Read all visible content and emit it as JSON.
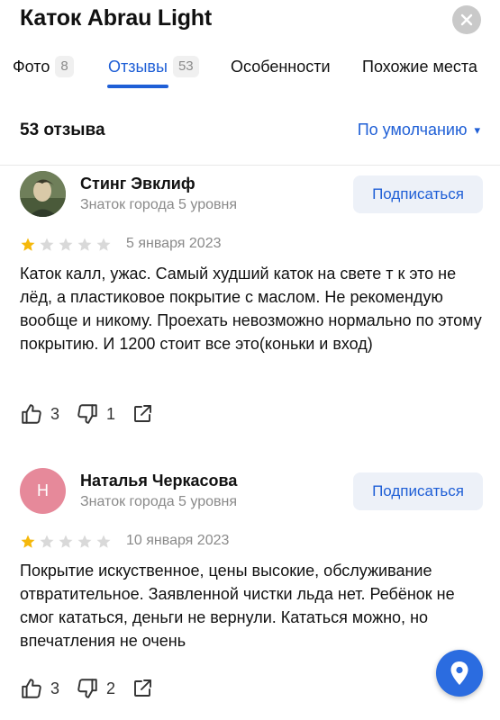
{
  "header": {
    "title": "Каток Abrau Light"
  },
  "tabs": [
    {
      "label": "Фото",
      "count": "8"
    },
    {
      "label": "Отзывы",
      "count": "53"
    },
    {
      "label": "Особенности"
    },
    {
      "label": "Похожие места"
    }
  ],
  "summary": {
    "count_text": "53 отзыва",
    "sort_label": "По умолчанию",
    "sort_caret": "▾"
  },
  "reviews": [
    {
      "author": "Стинг Эвклиф",
      "level": "Знаток города 5 уровня",
      "subscribe_label": "Подписаться",
      "rating": 1,
      "date": "5 января 2023",
      "text": "Каток калл, ужас. Самый худший каток на свете т к это не лёд, а пластиковое покрытие с маслом. Не рекомендую вообще и никому. Проехать невозможно нормально по этому покрытию. И 1200 стоит все это(коньки и вход)",
      "likes": "3",
      "dislikes": "1"
    },
    {
      "author": "Наталья Черкасова",
      "avatar_initial": "Н",
      "level": "Знаток города 5 уровня",
      "subscribe_label": "Подписаться",
      "rating": 1,
      "date": "10 января 2023",
      "text": "Покрытие искуственное, цены высокие, обслуживание отвратительное. Заявленной чистки льда нет. Ребёнок не смог кататься, деньги не вернули. Кататься можно, но впечатления не очень",
      "likes": "3",
      "dislikes": "2"
    }
  ],
  "colors": {
    "accent": "#1f5fd6",
    "star_filled": "#f5b80b",
    "star_empty": "#d9d9d9",
    "fab": "#2b6ce0"
  }
}
